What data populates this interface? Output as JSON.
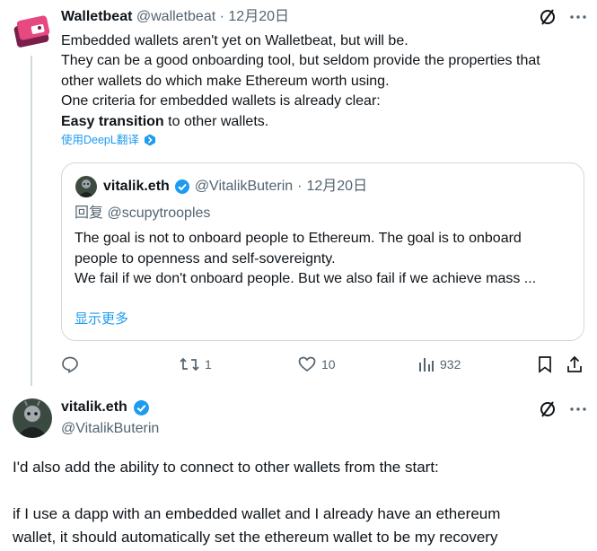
{
  "tweet": {
    "author_name": "Walletbeat",
    "author_handle": "@walletbeat",
    "separator": "·",
    "date": "12月20日",
    "lines": [
      "Embedded wallets aren't yet on Walletbeat, but will be.",
      "They can be a good onboarding tool, but seldom provide the properties that",
      "other wallets do which make Ethereum worth using.",
      "One criteria for embedded wallets is already clear:"
    ],
    "bold_phrase": "Easy transition",
    "last_line_rest": " to other wallets.",
    "translate_label": "使用DeepL翻译",
    "icons": {
      "grok": "grok-slash-icon",
      "more": "more-dots-icon",
      "deepl": "deepl-icon"
    }
  },
  "quote": {
    "author_name": "vitalik.eth",
    "author_handle": "@VitalikButerin",
    "separator": "·",
    "date": "12月20日",
    "reply_to": "回复 @scupytrooples",
    "lines": [
      "The goal is not to onboard people to Ethereum. The goal is to onboard",
      "people to openness and self-sovereignty.",
      "",
      "We fail if we don't onboard people. But we also fail if we achieve mass ..."
    ],
    "show_more": "显示更多"
  },
  "actions": {
    "reply_count": "",
    "retweet_count": "1",
    "like_count": "10",
    "views_count": "932"
  },
  "reply": {
    "author_name": "vitalik.eth",
    "author_handle": "@VitalikButerin",
    "lines": [
      "I'd also add the ability to connect to other wallets from the start:",
      "",
      "if I use a dapp with an embedded wallet and I already have an ethereum",
      "wallet, it should automatically set the ethereum wallet to be my recovery"
    ]
  },
  "colors": {
    "text": "#0f1419",
    "muted": "#536471",
    "link": "#1d9bf0",
    "verified": "#1d9bf0",
    "border": "#cfd9de",
    "walletbeat_pink": "#d6336c"
  }
}
